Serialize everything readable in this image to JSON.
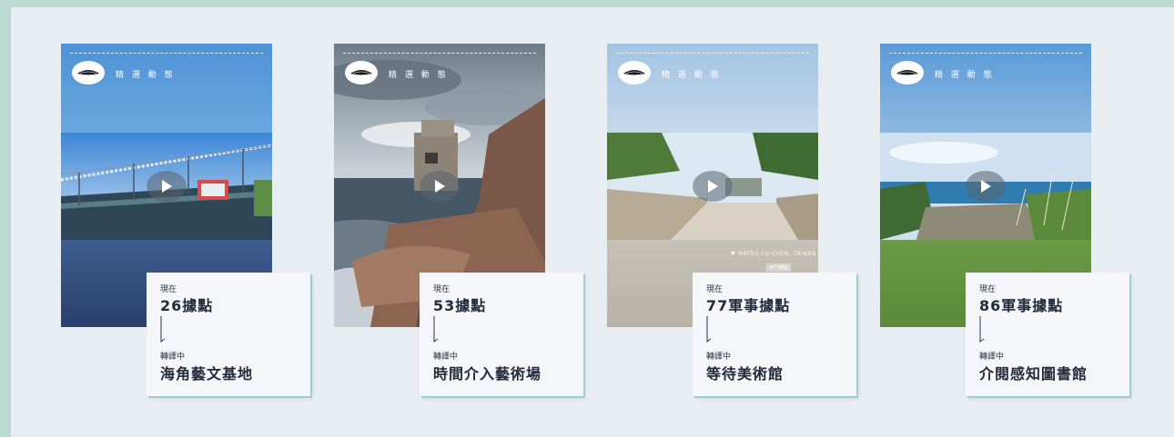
{
  "brand": {
    "label": "精 選 動 態",
    "logo_icon": "stingray-logo-icon",
    "play_icon": "play-icon"
  },
  "cards": [
    {
      "caption": "",
      "tag": "",
      "current_label": "現在",
      "current_name": "26據點",
      "converting_label": "轉譯中",
      "converting_name": "海角藝文基地"
    },
    {
      "caption": "",
      "tag": "",
      "current_label": "現在",
      "current_name": "53據點",
      "converting_label": "轉譯中",
      "converting_name": "時間介入藝術場"
    },
    {
      "caption": "♥ MATSU,FU-CHEN, TAINAN",
      "tag": "#77據點",
      "current_label": "現在",
      "current_name": "77軍事據點",
      "converting_label": "轉譯中",
      "converting_name": "等待美術館"
    },
    {
      "caption": "",
      "tag": "",
      "current_label": "現在",
      "current_name": "86軍事據點",
      "converting_label": "轉譯中",
      "converting_name": "介閱感知圖書館"
    }
  ],
  "colors": {
    "page_border": "#bcdcd3",
    "stage_bg": "#e8edf1",
    "info_bg": "#f4f6fa",
    "info_shadow": "#9ccfcf"
  }
}
